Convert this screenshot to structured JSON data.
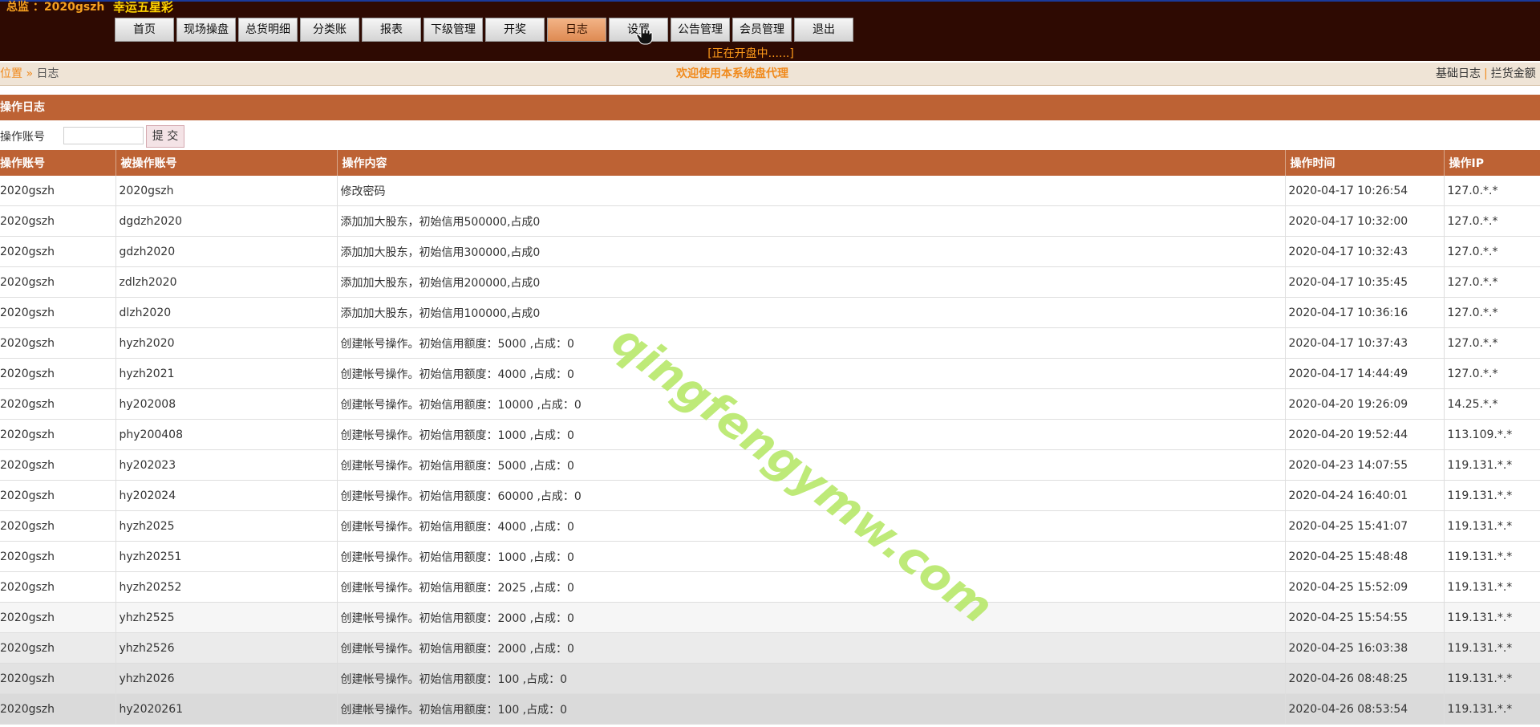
{
  "top": {
    "user_label": "总监 ：2020gszh",
    "system_title": "幸运五星彩",
    "nav": [
      {
        "label": "首页",
        "active": false
      },
      {
        "label": "现场操盘",
        "active": false
      },
      {
        "label": "总货明细",
        "active": false
      },
      {
        "label": "分类账",
        "active": false
      },
      {
        "label": "报表",
        "active": false
      },
      {
        "label": "下级管理",
        "active": false
      },
      {
        "label": "开奖",
        "active": false
      },
      {
        "label": "日志",
        "active": true
      },
      {
        "label": "设置",
        "active": false
      },
      {
        "label": "公告管理",
        "active": false
      },
      {
        "label": "会员管理",
        "active": false
      },
      {
        "label": "退出",
        "active": false
      }
    ],
    "status": "[正在开盘中......]"
  },
  "infobar": {
    "crumb_link": "位置",
    "crumb_sep": "»",
    "crumb_current": "日志",
    "welcome": "欢迎使用本系统盘代理",
    "right_link_1": "基础日志",
    "right_sep": "|",
    "right_link_2": "拦货金额"
  },
  "section": {
    "title": "操作日志"
  },
  "filter": {
    "label": "操作账号",
    "input_value": "",
    "submit_label": "提 交"
  },
  "table": {
    "headers": [
      "操作账号",
      "被操作账号",
      "操作内容",
      "操作时间",
      "操作IP"
    ],
    "rows": [
      [
        "2020gszh",
        "2020gszh",
        "修改密码",
        "2020-04-17 10:26:54",
        "127.0.*.*"
      ],
      [
        "2020gszh",
        "dgdzh2020",
        "添加加大股东，初始信用500000,占成0",
        "2020-04-17 10:32:00",
        "127.0.*.*"
      ],
      [
        "2020gszh",
        "gdzh2020",
        "添加加大股东，初始信用300000,占成0",
        "2020-04-17 10:32:43",
        "127.0.*.*"
      ],
      [
        "2020gszh",
        "zdlzh2020",
        "添加加大股东，初始信用200000,占成0",
        "2020-04-17 10:35:45",
        "127.0.*.*"
      ],
      [
        "2020gszh",
        "dlzh2020",
        "添加加大股东，初始信用100000,占成0",
        "2020-04-17 10:36:16",
        "127.0.*.*"
      ],
      [
        "2020gszh",
        "hyzh2020",
        "创建帐号操作。初始信用额度：5000 ,占成：0",
        "2020-04-17 10:37:43",
        "127.0.*.*"
      ],
      [
        "2020gszh",
        "hyzh2021",
        "创建帐号操作。初始信用额度：4000 ,占成：0",
        "2020-04-17 14:44:49",
        "127.0.*.*"
      ],
      [
        "2020gszh",
        "hy202008",
        "创建帐号操作。初始信用额度：10000 ,占成：0",
        "2020-04-20 19:26:09",
        "14.25.*.*"
      ],
      [
        "2020gszh",
        "phy200408",
        "创建帐号操作。初始信用额度：1000 ,占成：0",
        "2020-04-20 19:52:44",
        "113.109.*.*"
      ],
      [
        "2020gszh",
        "hy202023",
        "创建帐号操作。初始信用额度：5000 ,占成：0",
        "2020-04-23 14:07:55",
        "119.131.*.*"
      ],
      [
        "2020gszh",
        "hy202024",
        "创建帐号操作。初始信用额度：60000 ,占成：0",
        "2020-04-24 16:40:01",
        "119.131.*.*"
      ],
      [
        "2020gszh",
        "hyzh2025",
        "创建帐号操作。初始信用额度：4000 ,占成：0",
        "2020-04-25 15:41:07",
        "119.131.*.*"
      ],
      [
        "2020gszh",
        "hyzh20251",
        "创建帐号操作。初始信用额度：1000 ,占成：0",
        "2020-04-25 15:48:48",
        "119.131.*.*"
      ],
      [
        "2020gszh",
        "hyzh20252",
        "创建帐号操作。初始信用额度：2025 ,占成：0",
        "2020-04-25 15:52:09",
        "119.131.*.*"
      ],
      [
        "2020gszh",
        "yhzh2525",
        "创建帐号操作。初始信用额度：2000 ,占成：0",
        "2020-04-25 15:54:55",
        "119.131.*.*"
      ],
      [
        "2020gszh",
        "yhzh2526",
        "创建帐号操作。初始信用额度：2000 ,占成：0",
        "2020-04-25 16:03:38",
        "119.131.*.*"
      ],
      [
        "2020gszh",
        "yhzh2026",
        "创建帐号操作。初始信用额度：100 ,占成：0",
        "2020-04-26 08:48:25",
        "119.131.*.*"
      ],
      [
        "2020gszh",
        "hy2020261",
        "创建帐号操作。初始信用额度：100 ,占成：0",
        "2020-04-26 08:53:54",
        "119.131.*.*"
      ]
    ]
  },
  "watermark": "qingfengymw.com",
  "colors": {
    "top_bg": "#2e0a02",
    "accent": "#bd6234",
    "active_tab": "#e7a06e",
    "highlight_text": "#f08a1c",
    "title_yellow": "#ffd400",
    "watermark": "#b7e86a"
  }
}
